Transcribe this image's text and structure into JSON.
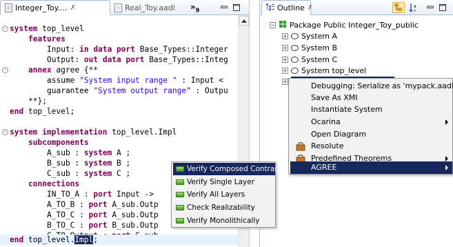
{
  "editor": {
    "tabs": [
      {
        "label": "Integer_Toy.... ",
        "close": "✗"
      },
      {
        "label": "Real_Toy.aadl"
      }
    ],
    "overflow": "»",
    "overflow_count": "9",
    "code_lines": [
      {
        "text": "system top_level",
        "kw": "system",
        "rest": " top_level",
        "fold": "⊖"
      },
      {
        "text": "features",
        "indent": 4,
        "kw": "features"
      },
      {
        "text": "Input: in data port Base_Types::Integer",
        "indent": 8,
        "parts": [
          "Input: ",
          "in data port",
          " Base_Types::Integer"
        ]
      },
      {
        "text": "Output: out data port Base_Types::Integ",
        "indent": 8,
        "parts": [
          "Output: ",
          "out data port",
          " Base_Types::Integ"
        ]
      },
      {
        "text": "annex agree {**",
        "indent": 4,
        "parts": [
          "annex",
          " agree {**"
        ],
        "fold": "⊖"
      },
      {
        "text": "assume \"System input range \" : Input <",
        "indent": 8,
        "parts": [
          "assume ",
          "\"System input range \"",
          " : Input <"
        ]
      },
      {
        "text": "guarantee \"System output range\" : Outpu",
        "indent": 8,
        "parts": [
          "guarantee ",
          "\"System output range\"",
          " : Outpu"
        ]
      },
      {
        "text": "**};",
        "indent": 4
      },
      {
        "text": "end top_level;",
        "parts": [
          "end",
          " top_level;"
        ]
      },
      {
        "text": ""
      },
      {
        "text": "system implementation top_level.Impl",
        "parts": [
          "system implementation",
          " top_level.Impl"
        ],
        "fold": "⊖"
      },
      {
        "text": "subcomponents",
        "indent": 4,
        "kw": "subcomponents"
      },
      {
        "text": "A_sub : system A ;",
        "indent": 8,
        "parts": [
          "A_sub : ",
          "system",
          " A ;"
        ]
      },
      {
        "text": "B_sub : system B ;",
        "indent": 8,
        "parts": [
          "B_sub : ",
          "system",
          " B ;"
        ]
      },
      {
        "text": "C_sub : system C ;",
        "indent": 8,
        "parts": [
          "C_sub : ",
          "system",
          " C ;"
        ]
      },
      {
        "text": "connections",
        "indent": 4,
        "kw": "connections"
      },
      {
        "text": "IN_TO_A : port Input ->",
        "indent": 8,
        "parts": [
          "IN_TO_A : ",
          "port",
          " Input ->"
        ]
      },
      {
        "text": "A_TO_B : port A_sub.Outp",
        "indent": 8,
        "parts": [
          "A_TO_B : ",
          "port",
          " A_sub.Outp"
        ]
      },
      {
        "text": "A_TO_C : port A_sub.Outp",
        "indent": 8,
        "parts": [
          "A_TO_C : ",
          "port",
          " A_sub.Outp"
        ]
      },
      {
        "text": "B_TO_C : port B_sub.Outp",
        "indent": 8,
        "parts": [
          "B_TO_C : ",
          "port",
          " B_sub.Outp"
        ]
      },
      {
        "text": "C_TO_Output : port C_sub",
        "indent": 8,
        "parts": [
          "C_TO_Output : ",
          "port",
          " C_sub"
        ]
      },
      {
        "text": "end top_level.Impl;",
        "parts": [
          "end",
          " top_level.",
          "Impl",
          ";"
        ]
      }
    ]
  },
  "outline": {
    "tab_label": "Outline",
    "tab_close": "✗",
    "tree": [
      {
        "label": "Package Public Integer_Toy_public",
        "expander": "⊖"
      },
      {
        "label": "System A",
        "expander": "⊞"
      },
      {
        "label": "System B",
        "expander": "⊞"
      },
      {
        "label": "System C",
        "expander": "⊞"
      },
      {
        "label": "System top_level",
        "expander": "⊞"
      },
      {
        "label": "",
        "expander": "⊞"
      }
    ]
  },
  "context_menu": {
    "items": [
      {
        "label": "Debugging: Serialize as 'mypack.aadl' text"
      },
      {
        "label": "Save As XMI"
      },
      {
        "label": "Instantiate System"
      },
      {
        "label": "Ocarina",
        "submenu": true
      },
      {
        "label": "Open Diagram"
      },
      {
        "label": "Resolute",
        "icon": "resolute-icon"
      },
      {
        "label": "Predefined Theorems",
        "icon": "resolute-icon",
        "submenu": true
      },
      {
        "label": "AGREE",
        "submenu": true,
        "selected": true
      }
    ]
  },
  "agree_submenu": {
    "items": [
      {
        "label": "Verify Composed Contract",
        "selected": true
      },
      {
        "label": "Verify Single Layer"
      },
      {
        "label": "Verify All Layers"
      },
      {
        "label": "Check Realizability"
      },
      {
        "label": "Verify Monolithically"
      }
    ]
  },
  "colors": {
    "keyword": "#7f0055",
    "string": "#2a00ff",
    "menu_highlight": "#15275c",
    "package_icon": "#2e9a2e"
  }
}
